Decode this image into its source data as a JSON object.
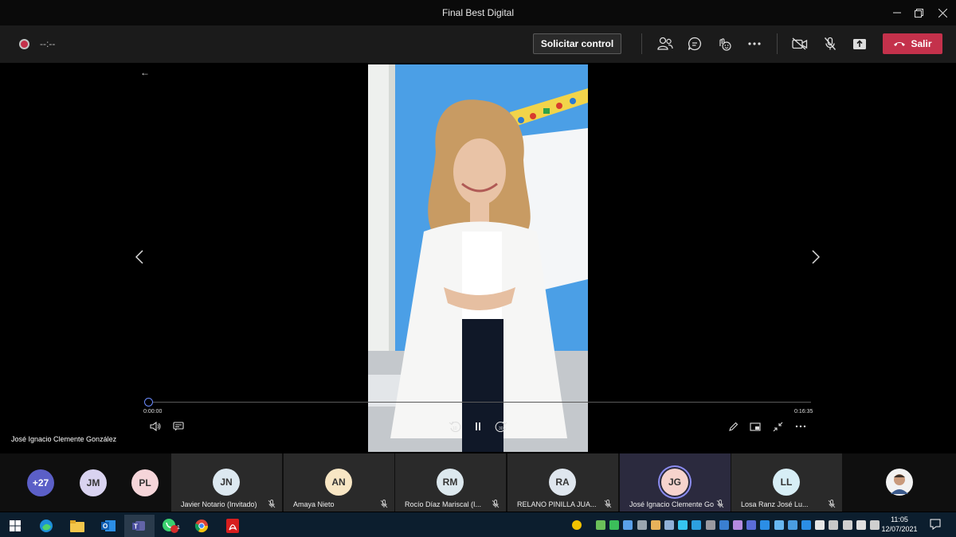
{
  "window": {
    "title": "Final Best Digital"
  },
  "toolbar": {
    "timer": "--:--",
    "request_control_label": "Solicitar control",
    "leave_label": "Salir",
    "icons": [
      "participants-icon",
      "chat-icon",
      "reactions-icon",
      "more-icon",
      "camera-off-icon",
      "mic-off-icon",
      "share-icon"
    ]
  },
  "player": {
    "current_time": "0:00:00",
    "duration": "0:16:35",
    "progress_fraction": 0.0,
    "presenter": "José Ignacio Clemente González"
  },
  "roster": {
    "overflow": [
      {
        "initials": "+27",
        "color": "#5b5fc7"
      },
      {
        "initials": "JM",
        "color": "#d9d3f0"
      },
      {
        "initials": "PL",
        "color": "#f5d5d9"
      }
    ],
    "participants": [
      {
        "initials": "JN",
        "name": "Javier Notario (Invitado)",
        "color": "#dce8f0"
      },
      {
        "initials": "AN",
        "name": "Amaya Nieto",
        "color": "#f8e6c4"
      },
      {
        "initials": "RM",
        "name": "Rocío Díaz Mariscal (I...",
        "color": "#dce8ee"
      },
      {
        "initials": "RA",
        "name": "RELANO PINILLA JUA...",
        "color": "#dfe6ee"
      },
      {
        "initials": "JG",
        "name": "José Ignacio Clemente Go...",
        "color": "#f6d3cd"
      },
      {
        "initials": "LL",
        "name": "Losa Ranz José Lu...",
        "color": "#d7eef6"
      }
    ]
  },
  "taskbar": {
    "apps": [
      "windows-start-icon",
      "edge-icon",
      "file-explorer-icon",
      "outlook-icon",
      "teams-icon",
      "whatsapp-icon",
      "chrome-icon",
      "acrobat-icon"
    ],
    "whatsapp_badge": "1",
    "time": "11:05",
    "date": "12/07/2021"
  },
  "colors": {
    "accent": "#5b5fc7",
    "leave": "#c4314b",
    "taskbar": "#0c1e2e"
  }
}
